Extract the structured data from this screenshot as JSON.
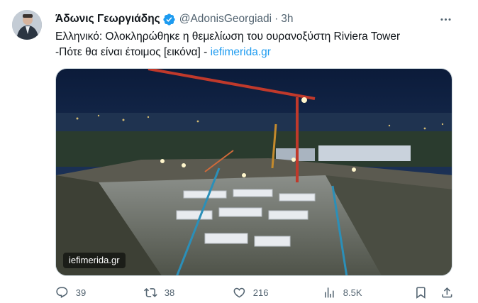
{
  "author": {
    "name": "Άδωνις Γεωργιάδης",
    "handle": "@AdonisGeorgiadi",
    "separator": "·",
    "time": "3h"
  },
  "tweet": {
    "text_line1": "Ελληνικό: Ολοκληρώθηκε η θεμελίωση του ουρανοξύστη Riviera Tower",
    "text_line2": "-Πότε θα είναι έτοιμος [εικόνα] - ",
    "link": "iefimerida.gr"
  },
  "media": {
    "source_label": "iefimerida.gr"
  },
  "actions": {
    "replies": "39",
    "retweets": "38",
    "likes": "216",
    "views": "8.5K"
  },
  "icons": {
    "verified": "verified-badge-icon",
    "more": "more-horizontal-icon",
    "reply": "reply-icon",
    "retweet": "retweet-icon",
    "like": "heart-icon",
    "views": "views-bar-chart-icon",
    "bookmark": "bookmark-icon",
    "share": "share-icon"
  },
  "colors": {
    "accent": "#1d9bf0",
    "text": "#0f1419",
    "muted": "#536471"
  }
}
